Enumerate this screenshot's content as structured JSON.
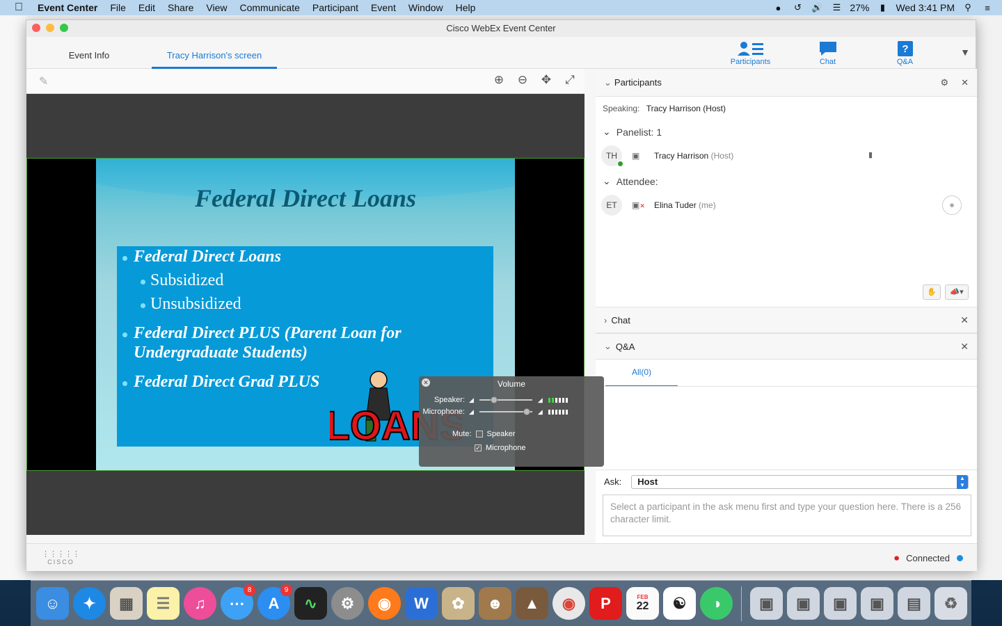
{
  "menubar": {
    "app_name": "Event Center",
    "items": [
      "File",
      "Edit",
      "Share",
      "View",
      "Communicate",
      "Participant",
      "Event",
      "Window",
      "Help"
    ],
    "battery": "27%",
    "clock": "Wed 3:41 PM"
  },
  "window": {
    "title": "Cisco WebEx Event Center"
  },
  "tabs": {
    "event_info": "Event Info",
    "screen": "Tracy Harrison's screen"
  },
  "panel_buttons": {
    "participants": "Participants",
    "chat": "Chat",
    "qa": "Q&A"
  },
  "slide": {
    "title": "Federal Direct Loans",
    "bullet1": "Federal Direct Loans",
    "sub1": "Subsidized",
    "sub2": "Unsubsidized",
    "bullet2a": "Federal Direct PLUS (Parent Loan for",
    "bullet2b": "Undergraduate Students)",
    "bullet3": "Federal Direct Grad PLUS",
    "art_text": "LOANS"
  },
  "volume": {
    "title": "Volume",
    "speaker_label": "Speaker:",
    "microphone_label": "Microphone:",
    "mute_label": "Mute:",
    "mute_speaker": "Speaker",
    "mute_microphone": "Microphone",
    "speaker_level": 0.25,
    "microphone_level": 0.95,
    "mute_speaker_checked": false,
    "mute_microphone_checked": true
  },
  "participants": {
    "header": "Participants",
    "speaking_label": "Speaking:",
    "speaking_name": "Tracy Harrison (Host)",
    "panelist_group": "Panelist: 1",
    "panelist": {
      "initials": "TH",
      "name": "Tracy Harrison",
      "role": "(Host)"
    },
    "attendee_group": "Attendee:",
    "attendee": {
      "initials": "ET",
      "name": "Elina Tuder",
      "role": "(me)"
    }
  },
  "chat": {
    "header": "Chat"
  },
  "qa": {
    "header": "Q&A",
    "tab_all": "All(0)",
    "ask_label": "Ask:",
    "ask_value": "Host",
    "placeholder": "Select a participant in the ask menu first and type your question here. There is a 256 character limit."
  },
  "status": {
    "brand": "CISCO",
    "connection": "Connected"
  },
  "dock": {
    "messages_badge": "8",
    "appstore_badge": "9",
    "calendar_month": "FEB",
    "calendar_day": "22"
  }
}
